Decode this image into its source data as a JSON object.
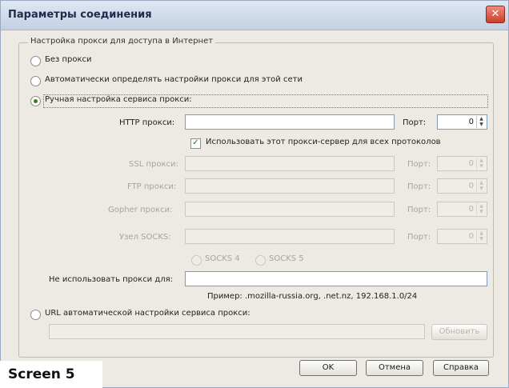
{
  "window": {
    "title": "Параметры соединения",
    "close_glyph": "✕"
  },
  "group": {
    "legend": "Настройка прокси для доступа в Интернет"
  },
  "options": {
    "no_proxy": "Без прокси",
    "auto_detect": "Автоматически определять настройки прокси для этой сети",
    "manual": "Ручная настройка сервиса прокси:",
    "auto_url": "URL автоматической настройки сервиса прокси:"
  },
  "selected_option": "manual",
  "proxies": {
    "http": {
      "label": "HTTP прокси:",
      "value": "",
      "port_label": "Порт:",
      "port": "0"
    },
    "same_for_all": {
      "label": "Использовать этот прокси-сервер для всех протоколов",
      "checked": true
    },
    "ssl": {
      "label": "SSL прокси:",
      "value": "",
      "port_label": "Порт:",
      "port": "0"
    },
    "ftp": {
      "label": "FTP прокси:",
      "value": "",
      "port_label": "Порт:",
      "port": "0"
    },
    "gopher": {
      "label": "Gopher прокси:",
      "value": "",
      "port_label": "Порт:",
      "port": "0"
    },
    "socks": {
      "label": "Узел SOCKS:",
      "value": "",
      "port_label": "Порт:",
      "port": "0"
    },
    "socks_v4": "SOCKS 4",
    "socks_v5": "SOCKS 5"
  },
  "no_proxy_for": {
    "label": "Не использовать прокси для:",
    "value": "",
    "example": "Пример: .mozilla-russia.org, .net.nz, 192.168.1.0/24"
  },
  "auto_url": {
    "value": "",
    "reload_label": "Обновить"
  },
  "buttons": {
    "ok": "OK",
    "cancel": "Отмена",
    "help": "Справка"
  },
  "caption": "Screen 5",
  "icons": {
    "spinner_up": "▲",
    "spinner_down": "▼",
    "check": "✓"
  }
}
